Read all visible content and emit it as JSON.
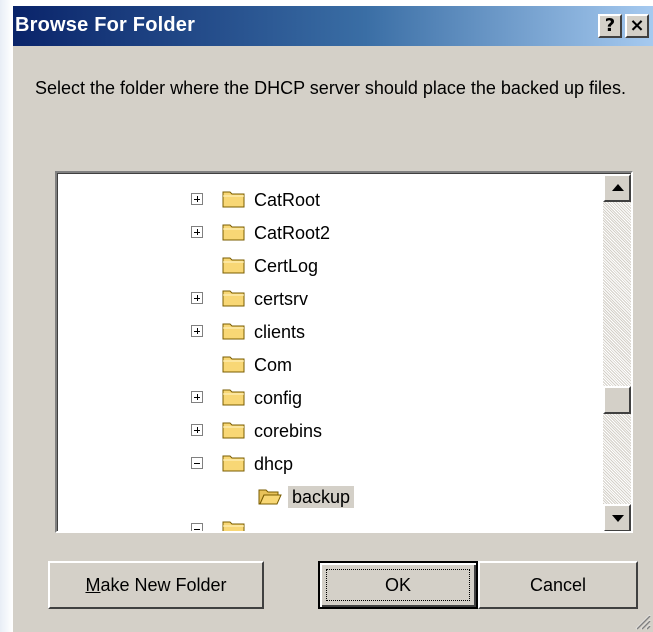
{
  "window": {
    "title": "Browse For Folder",
    "help_button": "?",
    "close_button": "×"
  },
  "instructions": "Select the folder where the DHCP server should place the backed up files.",
  "tree": {
    "items": [
      {
        "label": "CatRoot",
        "expander": "plus",
        "selected": false,
        "open": false
      },
      {
        "label": "CatRoot2",
        "expander": "plus",
        "selected": false,
        "open": false
      },
      {
        "label": "CertLog",
        "expander": "none",
        "selected": false,
        "open": false
      },
      {
        "label": "certsrv",
        "expander": "plus",
        "selected": false,
        "open": false
      },
      {
        "label": "clients",
        "expander": "plus",
        "selected": false,
        "open": false
      },
      {
        "label": "Com",
        "expander": "none",
        "selected": false,
        "open": false
      },
      {
        "label": "config",
        "expander": "plus",
        "selected": false,
        "open": false
      },
      {
        "label": "corebins",
        "expander": "plus",
        "selected": false,
        "open": false
      },
      {
        "label": "dhcp",
        "expander": "minus",
        "selected": false,
        "open": false
      },
      {
        "label": "backup",
        "expander": "none",
        "selected": true,
        "open": true
      }
    ]
  },
  "scrollbar": {
    "position_fraction": 0.67
  },
  "buttons": {
    "make_new_folder_mnemonic": "M",
    "make_new_folder_rest": "ake New Folder",
    "ok": "OK",
    "cancel": "Cancel"
  },
  "colors": {
    "titlebar_start": "#0a246a",
    "titlebar_end": "#a6caf0",
    "dialog_face": "#d4d0c8",
    "folder_fill": "#f8d775"
  },
  "icons": {
    "folder": "folder-icon",
    "open_folder": "open-folder-icon",
    "expand": "plus-box-icon",
    "collapse": "minus-box-icon",
    "scroll_up": "triangle-up-icon",
    "scroll_down": "triangle-down-icon",
    "resize_grip": "resize-grip-icon"
  }
}
